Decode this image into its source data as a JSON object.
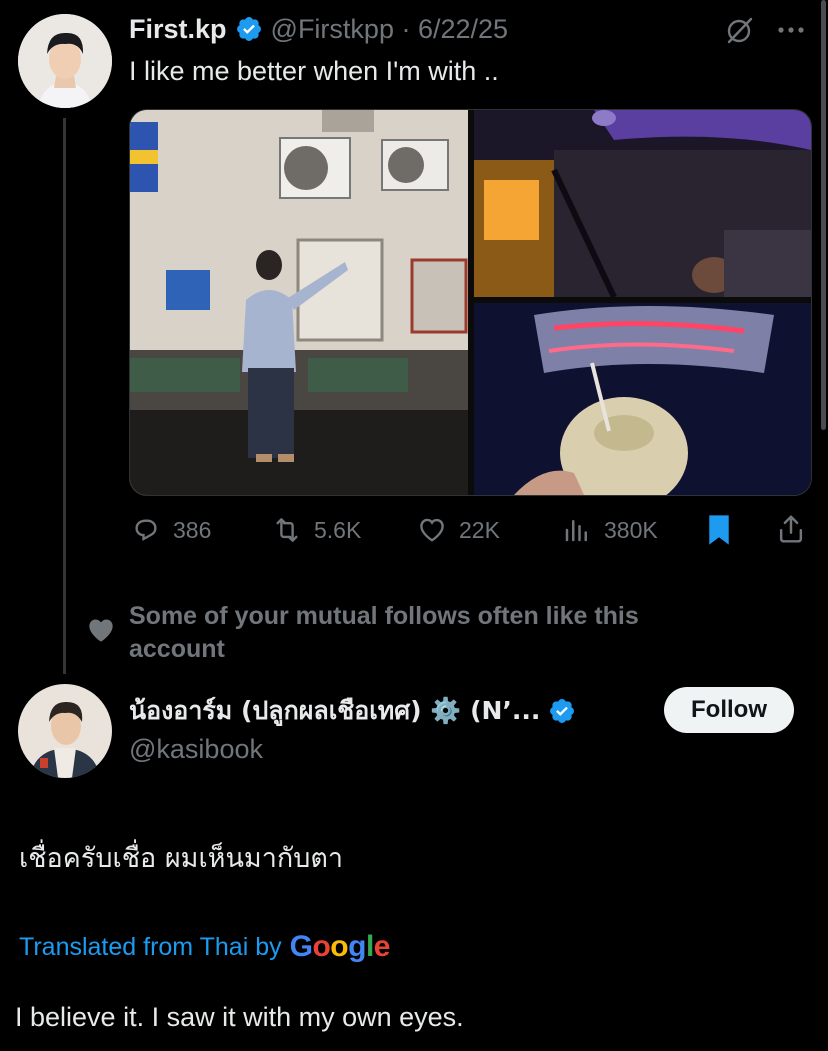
{
  "tweet": {
    "author_name": "First.kp",
    "handle_date": "@Firstkpp · 6/22/25",
    "text": "I like me better when I'm with ..",
    "actions": {
      "replies": "386",
      "reposts": "5.6K",
      "likes": "22K",
      "views": "380K"
    },
    "icons": {
      "verified": "verified-badge-icon",
      "grok": "grok-icon",
      "more": "more-icon"
    },
    "images": [
      "photo-man-pointing-at-wall",
      "photo-car-at-night",
      "photo-coconut-neon-sign"
    ]
  },
  "social_context": {
    "text": "Some of your mutual follows often like this account"
  },
  "reply": {
    "author_name": "น้องอาร์ม (ปลูกผลเชือเทศ) ⚙️ (N’...",
    "handle": "@kasibook",
    "follow_label": "Follow",
    "text": "เชื่อครับเชื่อ ผมเห็นมากับตา",
    "translated_label": "Translated from Thai by",
    "translator_brand": "Google",
    "translation": "I believe it. I saw it with my own eyes."
  },
  "colors": {
    "background": "#000000",
    "text": "#e7e9ea",
    "muted": "#71767b",
    "accent": "#1d9bf0"
  }
}
